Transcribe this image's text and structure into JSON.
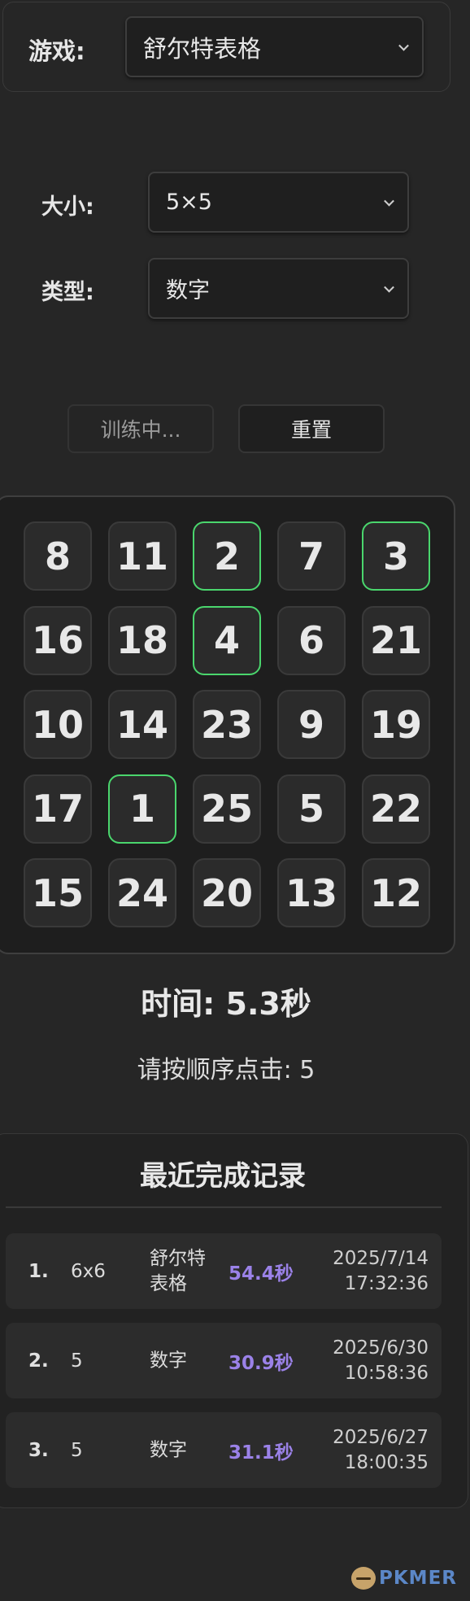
{
  "game": {
    "label": "游戏:",
    "value": "舒尔特表格"
  },
  "size": {
    "label": "大小:",
    "value": "5×5"
  },
  "type": {
    "label": "类型:",
    "value": "数字"
  },
  "buttons": {
    "training": "训练中...",
    "reset": "重置"
  },
  "grid": [
    [
      {
        "n": "8",
        "done": false
      },
      {
        "n": "11",
        "done": false
      },
      {
        "n": "2",
        "done": true
      },
      {
        "n": "7",
        "done": false
      },
      {
        "n": "3",
        "done": true
      }
    ],
    [
      {
        "n": "16",
        "done": false
      },
      {
        "n": "18",
        "done": false
      },
      {
        "n": "4",
        "done": true
      },
      {
        "n": "6",
        "done": false
      },
      {
        "n": "21",
        "done": false
      }
    ],
    [
      {
        "n": "10",
        "done": false
      },
      {
        "n": "14",
        "done": false
      },
      {
        "n": "23",
        "done": false
      },
      {
        "n": "9",
        "done": false
      },
      {
        "n": "19",
        "done": false
      }
    ],
    [
      {
        "n": "17",
        "done": false
      },
      {
        "n": "1",
        "done": true
      },
      {
        "n": "25",
        "done": false
      },
      {
        "n": "5",
        "done": false
      },
      {
        "n": "22",
        "done": false
      }
    ],
    [
      {
        "n": "15",
        "done": false
      },
      {
        "n": "24",
        "done": false
      },
      {
        "n": "20",
        "done": false
      },
      {
        "n": "13",
        "done": false
      },
      {
        "n": "12",
        "done": false
      }
    ]
  ],
  "status": {
    "timer": "时间: 5.3秒",
    "prompt": "请按顺序点击: 5"
  },
  "records": {
    "title": "最近完成记录",
    "items": [
      {
        "index": "1.",
        "size": "6x6",
        "type_line1": "舒尔特",
        "type_line2": "表格",
        "time": "54.4秒",
        "date": "2025/7/14",
        "clock": "17:32:36"
      },
      {
        "index": "2.",
        "size": "5",
        "type_line1": "数字",
        "type_line2": "",
        "time": "30.9秒",
        "date": "2025/6/30",
        "clock": "10:58:36"
      },
      {
        "index": "3.",
        "size": "5",
        "type_line1": "数字",
        "type_line2": "",
        "time": "31.1秒",
        "date": "2025/6/27",
        "clock": "18:00:35"
      }
    ]
  },
  "colors": {
    "accent_done": "#4ad66d",
    "time_highlight": "#9b82e8",
    "background": "#262626"
  },
  "watermark": {
    "text": "PKMER",
    "icon": "pkmer-logo-icon"
  }
}
